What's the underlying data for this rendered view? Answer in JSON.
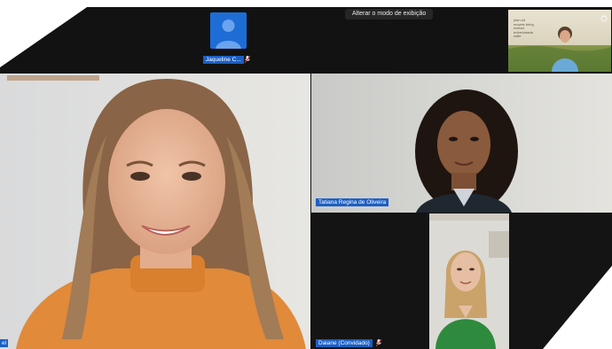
{
  "window": {
    "view_mode_button": "Alterar o modo de exibição"
  },
  "participants": [
    {
      "name": "Jaqueline C...",
      "muted": true,
      "video": false
    },
    {
      "name": "Tatiana Regina de Oliveira",
      "muted": false,
      "video": true
    },
    {
      "name": "Daiane (Convidado)",
      "muted": true,
      "video": true
    },
    {
      "name": "el",
      "muted": false,
      "video": true,
      "speaker": true
    }
  ],
  "thumbnail": {
    "slide_text": [
      "plan ed",
      "moveis bring",
      "melhor",
      "entrevistada",
      "nalie"
    ]
  },
  "colors": {
    "name_tag": "#1b5fc4",
    "background": "#121212",
    "avatar": "#1e6dd6"
  }
}
